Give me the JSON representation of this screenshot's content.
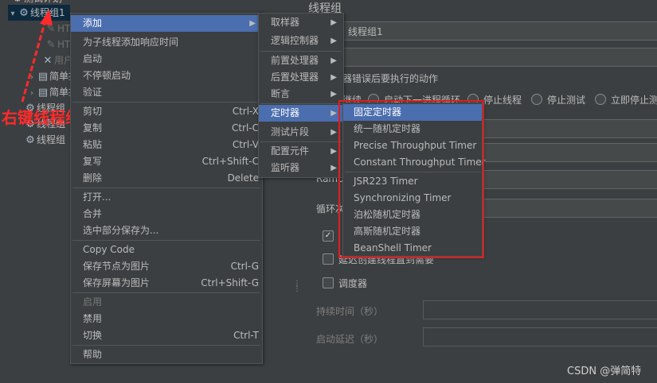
{
  "tree": {
    "items": [
      {
        "label": "线程组1",
        "selected": true
      },
      {
        "label": "HTTP请求",
        "dim": true
      },
      {
        "label": "HTTP请求",
        "dim": true
      },
      {
        "label": "用户定义的变量",
        "dim": true
      },
      {
        "label": "简单控制器"
      },
      {
        "label": "简单控制器"
      },
      {
        "label": "线程组"
      },
      {
        "label": "线程组"
      },
      {
        "label": "线程组"
      }
    ]
  },
  "annotation": {
    "text": "右键线程组",
    "color": "#ff2a2a"
  },
  "context_menu": {
    "items": [
      {
        "label": "添加",
        "has_submenu": true,
        "highlighted": true
      },
      {
        "label": "为子线程添加响应时间"
      },
      {
        "label": "启动"
      },
      {
        "label": "不停顿启动"
      },
      {
        "label": "验证"
      },
      {
        "label": "剪切",
        "shortcut": "Ctrl-X"
      },
      {
        "label": "复制",
        "shortcut": "Ctrl-C"
      },
      {
        "label": "粘贴",
        "shortcut": "Ctrl-V"
      },
      {
        "label": "复写",
        "shortcut": "Ctrl+Shift-C"
      },
      {
        "label": "删除",
        "shortcut": "Delete"
      },
      {
        "label": "打开..."
      },
      {
        "label": "合并"
      },
      {
        "label": "选中部分保存为..."
      },
      {
        "label": "Copy Code"
      },
      {
        "label": "保存节点为图片",
        "shortcut": "Ctrl-G"
      },
      {
        "label": "保存屏幕为图片",
        "shortcut": "Ctrl+Shift-G"
      },
      {
        "label": "启用",
        "disabled": true
      },
      {
        "label": "禁用"
      },
      {
        "label": "切换",
        "shortcut": "Ctrl-T"
      },
      {
        "label": "帮助"
      }
    ]
  },
  "add_submenu": {
    "items": [
      {
        "label": "取样器"
      },
      {
        "label": "逻辑控制器"
      },
      {
        "label": "前置处理器"
      },
      {
        "label": "后置处理器"
      },
      {
        "label": "断言"
      },
      {
        "label": "定时器",
        "highlighted": true
      },
      {
        "label": "测试片段"
      },
      {
        "label": "配置元件"
      },
      {
        "label": "监听器"
      }
    ]
  },
  "timer_submenu": {
    "items": [
      {
        "label": "固定定时器",
        "highlighted": true
      },
      {
        "label": "统一随机定时器"
      },
      {
        "label": "Precise Throughput Timer"
      },
      {
        "label": "Constant Throughput Timer"
      },
      {
        "label": "JSR223 Timer"
      },
      {
        "label": "Synchronizing Timer"
      },
      {
        "label": "泊松随机定时器"
      },
      {
        "label": "高斯随机定时器"
      },
      {
        "label": "BeanShell Timer"
      }
    ],
    "box_color": "#e01e1e"
  },
  "right_panel": {
    "title": "线程组",
    "name_value": "线程组1",
    "sampler_error_label": "器错误后要执行的动作",
    "radio_options": [
      "继续",
      "启动下一进程循环",
      "停止线程",
      "停止测试",
      "立即停止测试"
    ],
    "ramp_label": "Ramp",
    "loop_label": "循环次数",
    "delay_create_label": "延迟创建线程直到需要",
    "scheduler_label": "调度器",
    "duration_label": "持续时间（秒）",
    "startup_delay_label": "启动延迟（秒）"
  },
  "watermark": "CSDN @弹简特"
}
